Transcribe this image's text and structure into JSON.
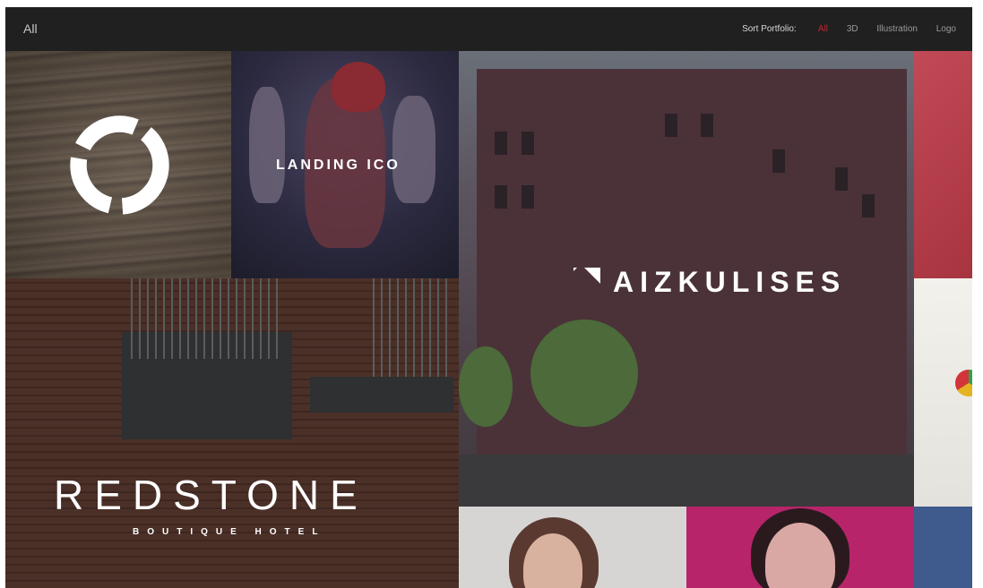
{
  "header": {
    "current_filter": "All",
    "sort_label": "Sort Portfolio:",
    "sort_options": [
      {
        "label": "All",
        "active": true
      },
      {
        "label": "3D",
        "active": false
      },
      {
        "label": "Illustration",
        "active": false
      },
      {
        "label": "Logo",
        "active": false
      }
    ]
  },
  "portfolio": {
    "landing": {
      "title": "LANDING ICO"
    },
    "aizkulises": {
      "title": "AIZKULISES"
    },
    "redstone": {
      "title": "REDSTONE",
      "subtitle": "BOUTIQUE HOTEL"
    }
  },
  "colors": {
    "accent": "#c0272d",
    "topbar": "#202020"
  }
}
